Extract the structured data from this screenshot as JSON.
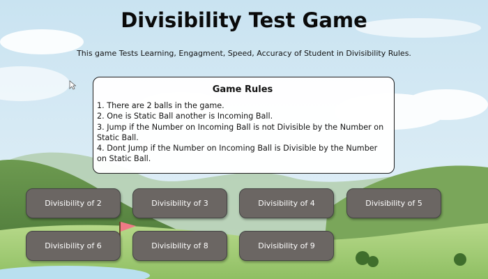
{
  "page": {
    "title": "Divisibility Test Game",
    "subtitle": "This game Tests Learning, Engagment, Speed, Accuracy of Student in Divisibility Rules."
  },
  "rules": {
    "title": "Game Rules",
    "items": [
      "1. There are 2 balls in the game.",
      "2. One is Static Ball another is Incoming Ball.",
      "3. Jump if the Number on Incoming Ball is not Divisible by the Number on Static Ball.",
      "4. Dont Jump if the Number on Incoming Ball is Divisible by the Number on Static Ball."
    ]
  },
  "buttons": [
    {
      "label": "Divisibility of 2"
    },
    {
      "label": "Divisibility of 3"
    },
    {
      "label": "Divisibility of 4"
    },
    {
      "label": "Divisibility of 5"
    },
    {
      "label": "Divisibility of 6"
    },
    {
      "label": "Divisibility of 8"
    },
    {
      "label": "Divisibility of 9"
    }
  ],
  "colors": {
    "sky": "#cfe6f2",
    "hill": "#5f8a45",
    "grass": "#9fc86f",
    "button_bg": "#6b6663",
    "button_text": "#ffffff",
    "flag": "#f07a86"
  },
  "icons": {
    "cursor": "arrow-cursor-icon"
  }
}
